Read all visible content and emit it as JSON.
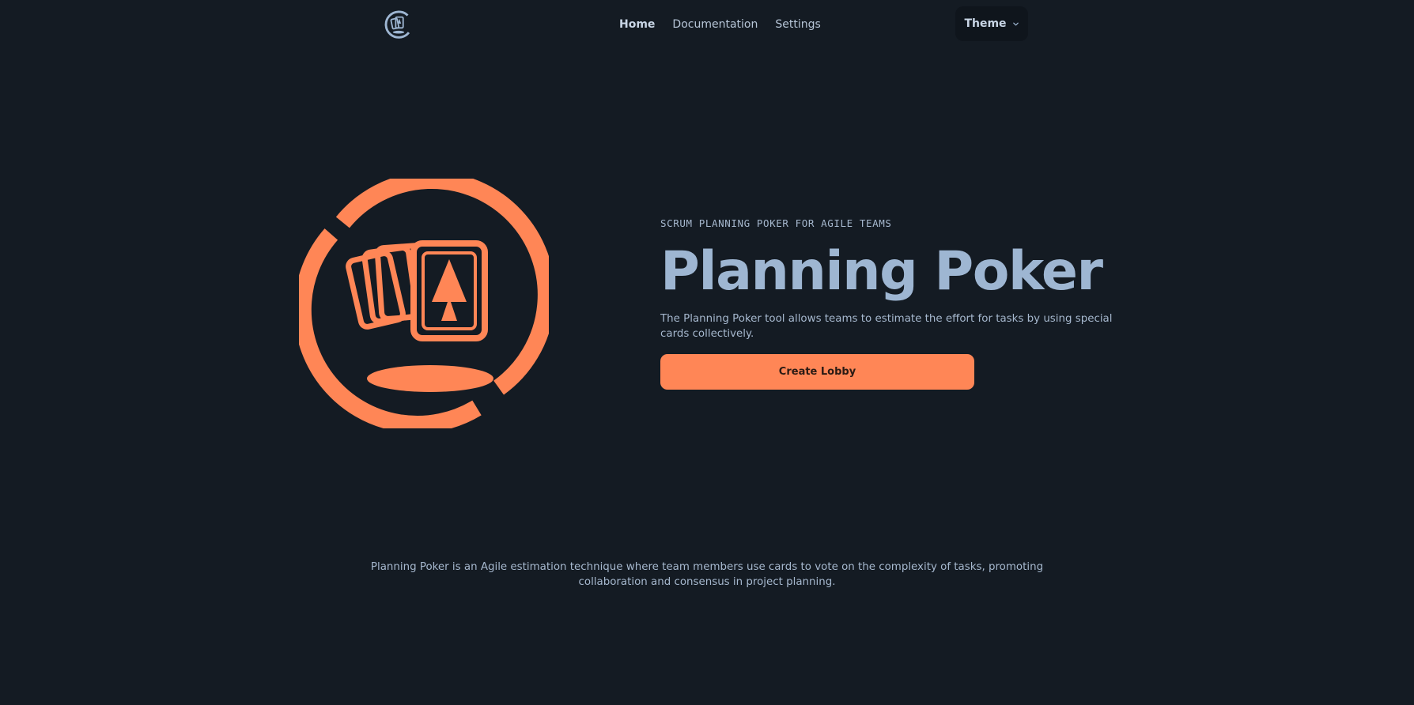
{
  "nav": {
    "logo_icon": "planning-poker-logo-icon",
    "links": [
      {
        "label": "Home",
        "active": true
      },
      {
        "label": "Documentation",
        "active": false
      },
      {
        "label": "Settings",
        "active": false
      }
    ],
    "theme_label": "Theme",
    "theme_icon": "chevron-down-icon"
  },
  "hero": {
    "logo_icon": "planning-poker-logo-icon",
    "eyebrow": "SCRUM PLANNING POKER FOR AGILE TEAMS",
    "title": "Planning Poker",
    "description": "The Planning Poker tool allows teams to estimate the effort for tasks by using special cards collectively.",
    "cta_label": "Create Lobby"
  },
  "blurb": "Planning Poker is an Agile estimation technique where team members use cards to vote on the complexity of tasks, promoting collaboration and consensus in project planning.",
  "colors": {
    "background": "#141b23",
    "accent": "#ff8656",
    "title": "#9eb6d2",
    "text": "#a6b8ce"
  }
}
